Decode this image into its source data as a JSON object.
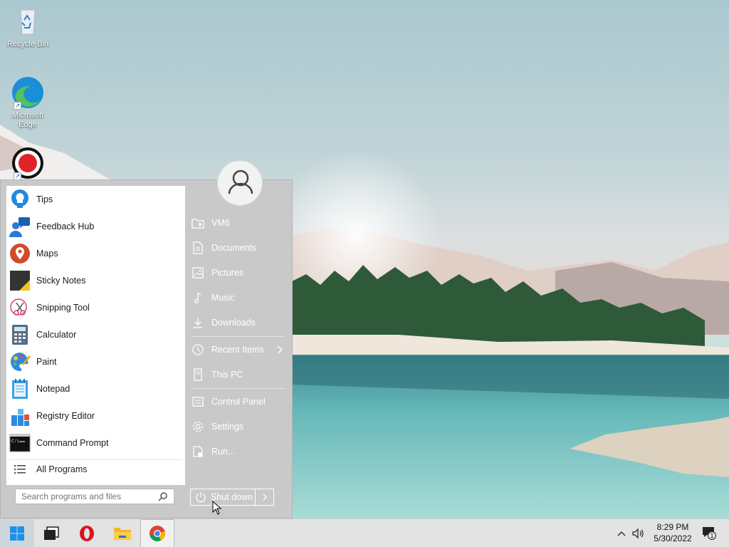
{
  "desktop": {
    "icons": [
      {
        "label": "Recycle Bin",
        "icon": "recycle-bin-icon"
      },
      {
        "label": "Microsoft Edge",
        "icon": "edge-icon"
      },
      {
        "label": "",
        "icon": "record-icon"
      }
    ]
  },
  "start_menu": {
    "programs": [
      {
        "label": "Tips",
        "icon": "tips-icon"
      },
      {
        "label": "Feedback Hub",
        "icon": "feedback-hub-icon"
      },
      {
        "label": "Maps",
        "icon": "maps-icon"
      },
      {
        "label": "Sticky Notes",
        "icon": "sticky-notes-icon"
      },
      {
        "label": "Snipping Tool",
        "icon": "snipping-tool-icon"
      },
      {
        "label": "Calculator",
        "icon": "calculator-icon"
      },
      {
        "label": "Paint",
        "icon": "paint-icon"
      },
      {
        "label": "Notepad",
        "icon": "notepad-icon"
      },
      {
        "label": "Registry Editor",
        "icon": "registry-editor-icon"
      },
      {
        "label": "Command Prompt",
        "icon": "command-prompt-icon"
      }
    ],
    "all_programs": "All Programs",
    "search_placeholder": "Search programs and files",
    "right_items": [
      {
        "label": "VM6",
        "icon": "user-folder-icon"
      },
      {
        "label": "Documents",
        "icon": "document-icon"
      },
      {
        "label": "Pictures",
        "icon": "picture-icon"
      },
      {
        "label": "Music",
        "icon": "music-icon"
      },
      {
        "label": "Downloads",
        "icon": "download-icon"
      },
      {
        "label": "Recent Items",
        "icon": "recent-icon"
      },
      {
        "label": "This PC",
        "icon": "computer-icon"
      },
      {
        "label": "Control Panel",
        "icon": "control-panel-icon"
      },
      {
        "label": "Settings",
        "icon": "gear-icon"
      },
      {
        "label": "Run...",
        "icon": "run-icon"
      }
    ],
    "shutdown_label": "Shut down"
  },
  "taskbar": {
    "apps": [
      "start",
      "task-view",
      "opera",
      "file-explorer",
      "chrome"
    ],
    "clock_time": "8:29 PM",
    "clock_date": "5/30/2022",
    "notification_count": "1"
  },
  "colors": {
    "start_accent": "#c9c9c9",
    "taskbar": "#e3e3e3",
    "windows_blue": "#1e90e8"
  }
}
